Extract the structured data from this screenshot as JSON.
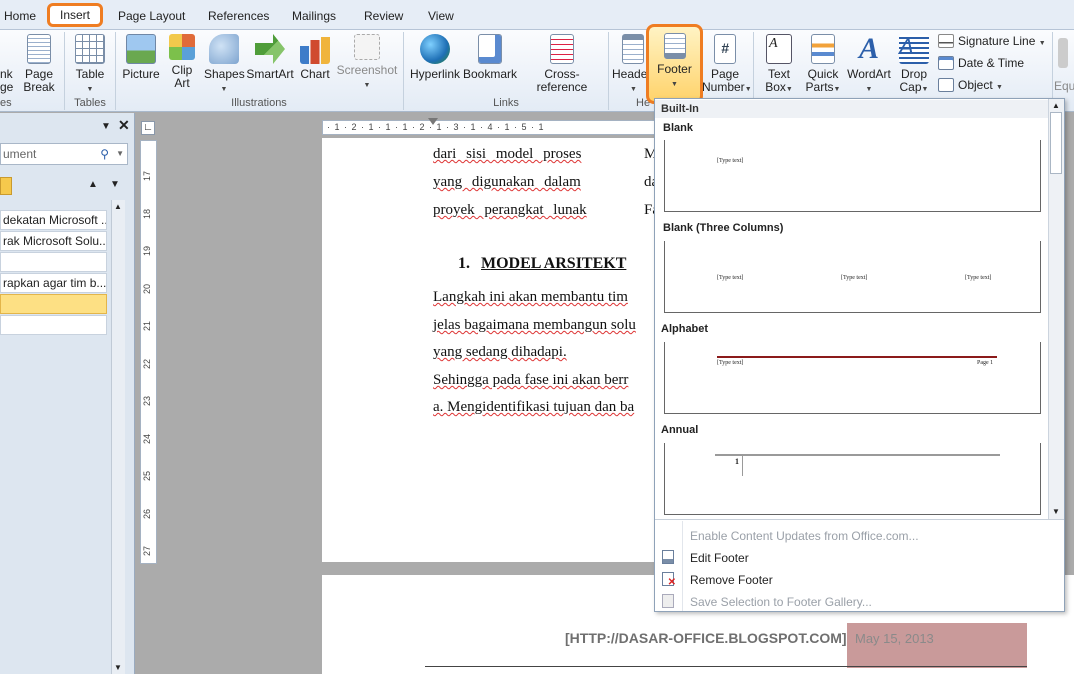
{
  "tabs": [
    "Home",
    "Insert",
    "Page Layout",
    "References",
    "Mailings",
    "Review",
    "View"
  ],
  "ribbon": {
    "partial_left": [
      "nk",
      "ge"
    ],
    "page_break": "Page Break",
    "groups": {
      "pages_partial": "es",
      "tables": "Tables",
      "illustrations": "Illustrations",
      "links": "Links",
      "header_partial": "He"
    },
    "table": "Table",
    "picture": "Picture",
    "clip_art": "Clip Art",
    "shapes": "Shapes",
    "smartart": "SmartArt",
    "chart": "Chart",
    "screenshot": "Screenshot",
    "hyperlink": "Hyperlink",
    "bookmark": "Bookmark",
    "cross_reference": "Cross-reference",
    "header": "Header",
    "footer": "Footer",
    "page_number": "Page Number",
    "text_box": "Text Box",
    "quick_parts": "Quick Parts",
    "wordart": "WordArt",
    "drop_cap": "Drop Cap",
    "signature_line": "Signature Line",
    "date_time": "Date & Time",
    "object": "Object",
    "equation_partial": "Equ"
  },
  "nav": {
    "search": "ument",
    "items": [
      "dekatan Microsoft ...",
      "rak Microsoft Solu...",
      "",
      "rapkan agar tim b...",
      ""
    ]
  },
  "ruler": {
    "h": "· 1 · 2 · 1 · 1 · 1 · 2 · 1 · 3 · 1 · 4 · 1 · 5 · 1",
    "v": [
      "17",
      "18",
      "19",
      "20",
      "21",
      "22",
      "23",
      "24",
      "25",
      "26",
      "27"
    ]
  },
  "document": {
    "col1": [
      "dari  sisi  model  proses",
      "yang  digunakan  dalam",
      "proyek  perangkat  lunak"
    ],
    "col2": [
      "M",
      "da",
      "Fa"
    ],
    "heading_num": "1.",
    "heading": "MODEL ARSITEKT",
    "para": [
      "Langkah  ini  akan  membantu  tim",
      "jelas  bagaimana   membangun  solu",
      "yang  sedang   dihadapi.",
      "Sehingga  pada  fase  ini  akan  berr",
      "a.  Mengidentifikasi  tujuan  dan  ba"
    ]
  },
  "page2": {
    "url": "[HTTP://DASAR-OFFICE.BLOGSPOT.COM]",
    "date": "May 15, 2013",
    "date_bg": "#c99a9a"
  },
  "gallery": {
    "builtin": "Built-In",
    "items": [
      {
        "title": "Blank",
        "texts": [
          "[Type text]"
        ]
      },
      {
        "title": "Blank (Three Columns)",
        "texts": [
          "[Type text]",
          "[Type text]",
          "[Type text]"
        ]
      },
      {
        "title": "Alphabet",
        "texts": [
          "[Type text]",
          "Page 1"
        ]
      },
      {
        "title": "Annual",
        "texts": [
          "1"
        ]
      }
    ],
    "menu": [
      "Enable Content Updates from Office.com...",
      "Edit Footer",
      "Remove Footer",
      "Save Selection to Footer Gallery..."
    ]
  },
  "colors": {
    "accent": "#ef7d22",
    "ribbon_bg": "#e3ebf5",
    "selection": "#ffd36b"
  }
}
